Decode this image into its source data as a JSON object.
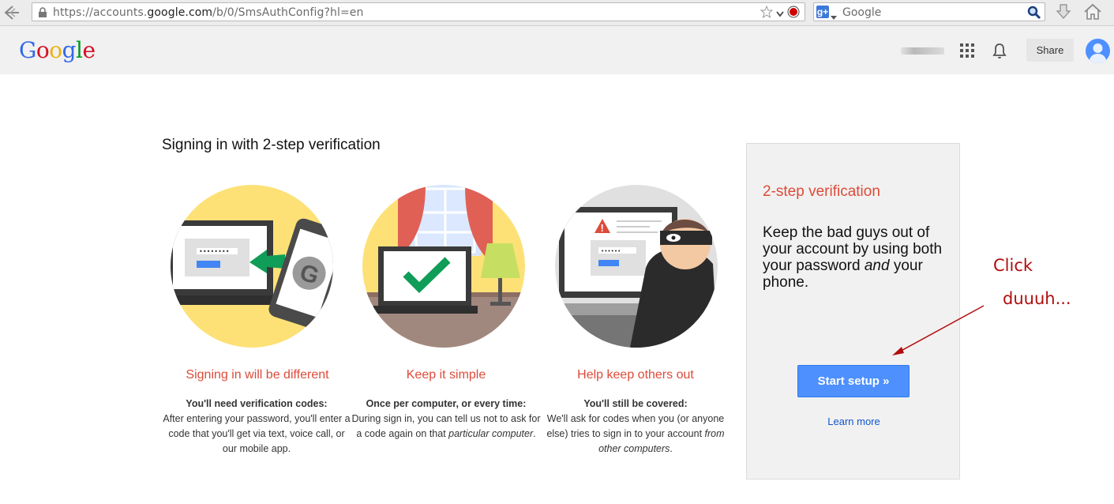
{
  "browser": {
    "url_prefix": "https://accounts.",
    "url_domain": "google.com",
    "url_rest": "/b/0/SmsAuthConfig?hl=en",
    "search_engine_badge": "g+",
    "search_placeholder": "Google"
  },
  "header": {
    "logo_letters": [
      "G",
      "o",
      "o",
      "g",
      "l",
      "e"
    ],
    "logo_colors": [
      "#3369e8",
      "#d50f25",
      "#eeb211",
      "#3369e8",
      "#009925",
      "#d50f25"
    ],
    "share_label": "Share"
  },
  "main": {
    "heading": "Signing in with 2-step verification",
    "features": [
      {
        "title": "Signing in will be different",
        "lead": "You'll need verification codes:",
        "desc_pre": "After entering your password, you'll enter a code that you'll get via text, voice call, or our mobile app.",
        "desc_em": "",
        "desc_post": ""
      },
      {
        "title": "Keep it simple",
        "lead": "Once per computer, or every time:",
        "desc_pre": "During sign in, you can tell us not to ask for a code again on that ",
        "desc_em": "particular computer",
        "desc_post": "."
      },
      {
        "title": "Help keep others out",
        "lead": "You'll still be covered:",
        "desc_pre": "We'll ask for codes when you (or anyone else) tries to sign in to your account ",
        "desc_em": "from other computers",
        "desc_post": "."
      }
    ]
  },
  "sidebox": {
    "title": "2-step verification",
    "body_pre": "Keep the bad guys out of your account by using both your password ",
    "body_em": "and",
    "body_post": " your phone.",
    "setup_button": "Start setup »",
    "learn_more": "Learn more"
  },
  "annotation": {
    "line1": "Click",
    "line2": "duuuh..."
  },
  "colors": {
    "accent_red": "#dd4b39",
    "button_blue": "#4d90fe",
    "link_blue": "#1155cc",
    "annotation_red": "#b10d0d"
  },
  "icons": [
    "back-arrow-icon",
    "lock-icon",
    "star-icon",
    "chevron-down-icon",
    "record-icon",
    "magnifier-icon",
    "download-icon",
    "home-icon",
    "apps-grid-icon",
    "bell-icon",
    "avatar-icon"
  ]
}
